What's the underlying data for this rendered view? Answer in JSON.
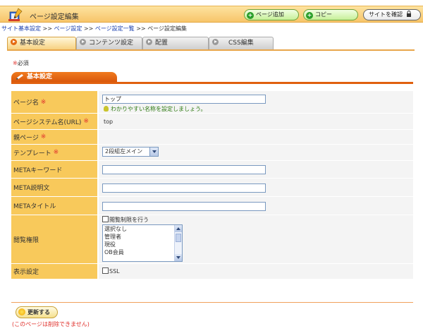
{
  "header": {
    "title": "ページ設定編集",
    "buttons": {
      "add": "ページ追加",
      "copy": "コピー",
      "view": "サイトを確認"
    },
    "icons": {
      "logo": "book-pencil-icon",
      "add": "plus-icon",
      "copy": "plus-icon",
      "view": "lock-icon"
    }
  },
  "breadcrumb": {
    "items": [
      "サイト基本設定",
      "ページ設定",
      "ページ設定一覧",
      "ページ設定編集"
    ],
    "separator": " >> "
  },
  "tabs": [
    {
      "label": "基本設定",
      "active": true
    },
    {
      "label": "コンテンツ設定",
      "active": false
    },
    {
      "label": "配置",
      "active": false
    },
    {
      "label": "CSS編集",
      "active": false
    }
  ],
  "required_note": {
    "mark": "※",
    "text": "必須"
  },
  "section": {
    "title": "基本設定"
  },
  "form": {
    "page_name": {
      "label": "ページ名",
      "required": "※",
      "value": "トップ",
      "hint": "わかりやすい名称を設定しましょう。"
    },
    "system_name": {
      "label": "ページシステム名(URL)",
      "required": "※",
      "value": "top"
    },
    "parent": {
      "label": "親ページ",
      "required": "※"
    },
    "template": {
      "label": "テンプレート",
      "required": "※",
      "selected": "2段組左メイン"
    },
    "meta_keywords": {
      "label": "METAキーワード",
      "value": ""
    },
    "meta_description": {
      "label": "META説明文",
      "value": ""
    },
    "meta_title": {
      "label": "METAタイトル",
      "value": ""
    },
    "access": {
      "label": "閲覧権限",
      "checkbox_label": "閲覧制限を行う",
      "options": [
        "選択なし",
        "管理者",
        "現役",
        "OB会員"
      ]
    },
    "display": {
      "label": "表示設定",
      "checkbox_label": "SSL"
    }
  },
  "footer": {
    "update_button": "更新する",
    "note": "(このページは削除できません)"
  },
  "colors": {
    "accent": "#e0600f",
    "label_bg": "#f8c95b",
    "required": "#e0302b",
    "link": "#1a3fae"
  }
}
